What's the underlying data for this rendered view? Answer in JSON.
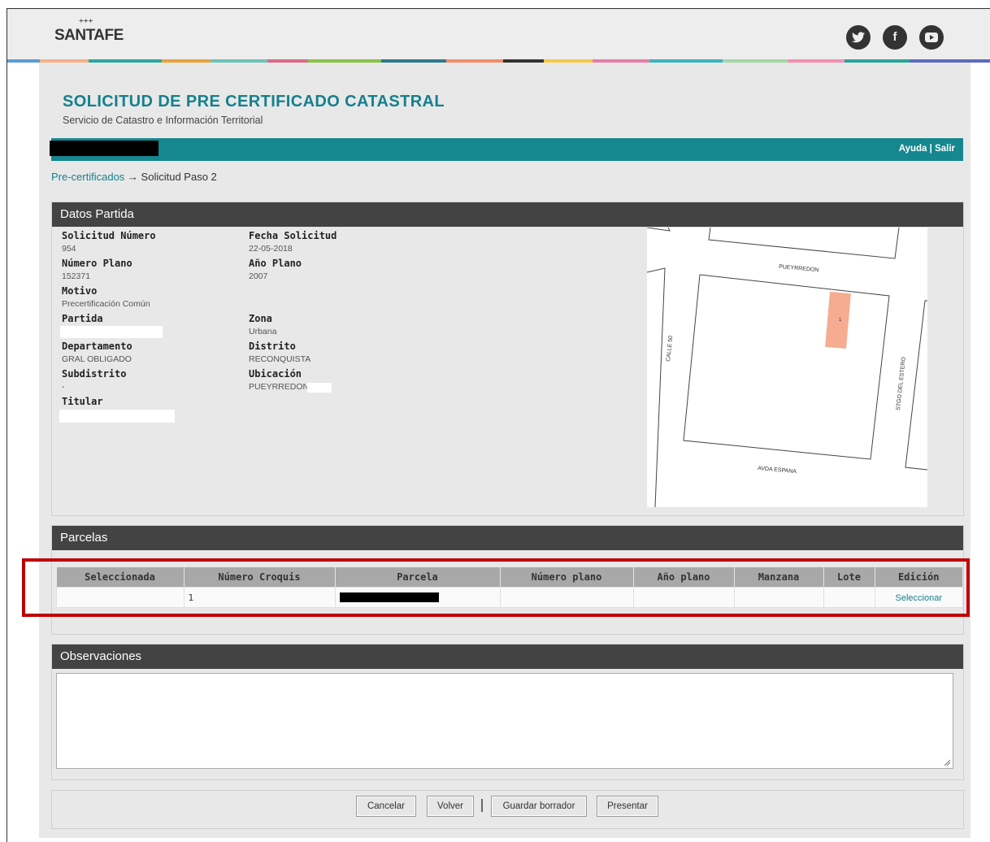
{
  "brand": {
    "logo_text": "SANTAFE"
  },
  "social": [
    {
      "name": "twitter-icon",
      "glyph": "t"
    },
    {
      "name": "facebook-icon",
      "glyph": "f"
    },
    {
      "name": "youtube-icon",
      "glyph": "▶"
    }
  ],
  "colors": {
    "accent": "#15878f",
    "panel_head": "#434343",
    "highlight": "#c00000"
  },
  "page": {
    "title": "SOLICITUD DE PRE CERTIFICADO CATASTRAL",
    "subtitle": "Servicio de Catastro e Información Territorial"
  },
  "topbar": {
    "help": "Ayuda",
    "separator": " | ",
    "logout": "Salir"
  },
  "breadcrumb": {
    "link": "Pre-certificados",
    "arrow": " → ",
    "current": "Solicitud Paso 2"
  },
  "datos": {
    "heading": "Datos Partida",
    "solicitud_label": "Solicitud Número",
    "solicitud_value": "954",
    "fecha_label": "Fecha Solicitud",
    "fecha_value": "22-05-2018",
    "plano_label": "Número Plano",
    "plano_value": "152371",
    "anio_label": "Año Plano",
    "anio_value": "2007",
    "motivo_label": "Motivo",
    "motivo_value": "Precertificación Común",
    "partida_label": "Partida",
    "zona_label": "Zona",
    "zona_value": "Urbana",
    "depto_label": "Departamento",
    "depto_value": "GRAL OBLIGADO",
    "distrito_label": "Distrito",
    "distrito_value": "RECONQUISTA",
    "subdistrito_label": "Subdistrito",
    "subdistrito_value": "-",
    "ubicacion_label": "Ubicación",
    "ubicacion_value": "PUEYRREDON",
    "titular_label": "Titular"
  },
  "map": {
    "street_top": "PUEYRREDON",
    "street_left": "CALLE 50",
    "street_right": "STGO DEL ESTERO",
    "street_bottom": "AVDA ESPANA",
    "parcel_label": "1"
  },
  "parcelas": {
    "heading": "Parcelas",
    "columns": [
      "Seleccionada",
      "Número Croquis",
      "Parcela",
      "Número plano",
      "Año plano",
      "Manzana",
      "Lote",
      "Edición"
    ],
    "row": {
      "seleccionada": "",
      "croquis": "1",
      "numero_plano": "",
      "anio_plano": "",
      "manzana": "",
      "lote": "",
      "edicion": "Seleccionar"
    }
  },
  "observaciones": {
    "heading": "Observaciones",
    "value": ""
  },
  "buttons": {
    "cancelar": "Cancelar",
    "volver": "Volver",
    "guardar": "Guardar borrador",
    "presentar": "Presentar"
  }
}
